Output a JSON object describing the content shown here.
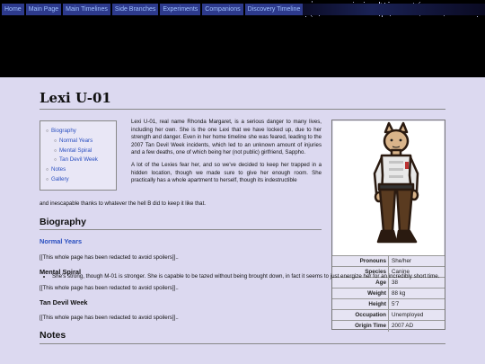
{
  "nav": {
    "items": [
      "Home",
      "Main Page",
      "Main Timelines",
      "Side Branches",
      "Experiments",
      "Companions",
      "Discovery Timeline"
    ]
  },
  "page": {
    "title": "Lexi U-01"
  },
  "toc": {
    "items": [
      {
        "label": "Biography",
        "sub": false
      },
      {
        "label": "Normal Years",
        "sub": true
      },
      {
        "label": "Mental Spiral",
        "sub": true
      },
      {
        "label": "Tan Devil Week",
        "sub": true
      },
      {
        "label": "Notes",
        "sub": false
      },
      {
        "label": "Gallery",
        "sub": false
      }
    ]
  },
  "intro": {
    "p1": "Lexi U-01, real name Rhonda Margaret, is a serious danger to many lives, including her own. She is the one Lexi that we have locked up, due to her strength and danger. Even in her home timeline she was feared, leading to the 2007 Tan Devil Week incidents, which led to an unknown amount of injuries and a few deaths, one of which being her (not public) girlfriend, Sappho.",
    "p2": "A lot of the Lexies fear her, and so we've decided to keep her trapped in a hidden location, though we made sure to give her enough room. She practically has a whole apartment to herself, though its indestructible",
    "p2_tail": "and inescapable thanks to whatever the hell B did to keep it like that."
  },
  "infobox": {
    "rows": [
      {
        "key": "Pronouns",
        "value": "She/her"
      },
      {
        "key": "Species",
        "value": "Canine"
      },
      {
        "key": "Age",
        "value": "38"
      },
      {
        "key": "Weight",
        "value": "88 kg"
      },
      {
        "key": "Height",
        "value": "5'7"
      },
      {
        "key": "Occupation",
        "value": "Unemployed"
      },
      {
        "key": "Origin Time",
        "value": "2007 AD"
      }
    ]
  },
  "biography": {
    "heading": "Biography",
    "normal_years": "Normal Years",
    "normal_years_text": "[[This whole page has been redacted to avoid spoilers]]..",
    "mental_spiral": "Mental Spiral",
    "mental_spiral_text": "[[This whole page has been redacted to avoid spoilers]]..",
    "tan_devil_week": "Tan Devil Week",
    "tan_devil_week_text": "[[This whole page has been redacted to avoid spoilers]].."
  },
  "notes": {
    "heading": "Notes",
    "items": [
      "She's strong, though M-01 is stronger. She is capable to be tazed without being brought down, in fact it seems to just energize her for an incredibly short time."
    ]
  },
  "colors": {
    "nav_bg": "#2d3a8c",
    "nav_text": "#9ec0ff",
    "content_bg": "#dcd9f0",
    "link": "#2a4fc0"
  }
}
